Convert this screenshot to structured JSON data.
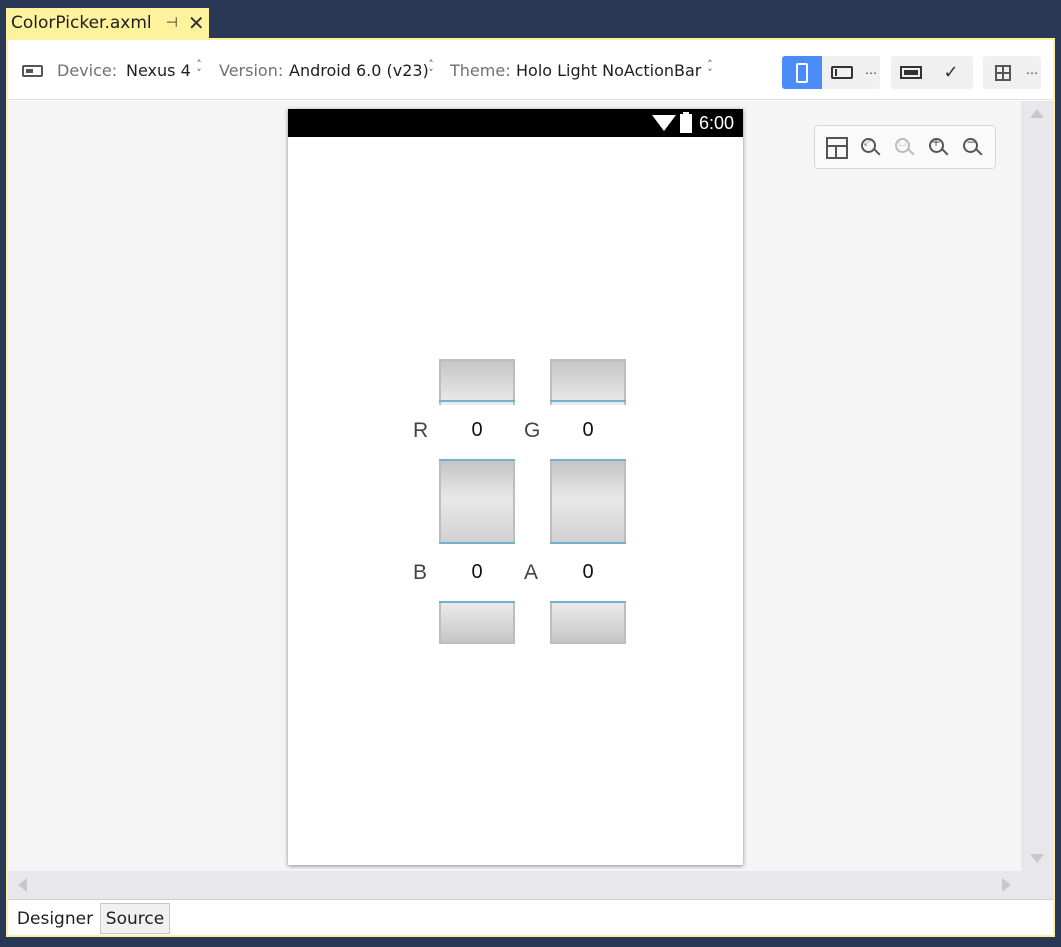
{
  "document_tab": {
    "title": "ColorPicker.axml",
    "pin_icon": "pin-icon",
    "close_icon": "close-icon"
  },
  "toolbar": {
    "device_label": "Device:",
    "device_value": "Nexus 4",
    "version_label": "Version:",
    "version_value": "Android 6.0 (v23)",
    "theme_label": "Theme:",
    "theme_value": "Holo Light NoActionBar",
    "more": "⋯",
    "accent_color": "#4b8df8"
  },
  "status_bar": {
    "time": "6:00"
  },
  "pickers": [
    {
      "label": "R",
      "value": "0"
    },
    {
      "label": "G",
      "value": "0"
    },
    {
      "label": "B",
      "value": "0"
    },
    {
      "label": "A",
      "value": "0"
    }
  ],
  "zoom_toolbar": {
    "icons": [
      "layout-icon",
      "zoom-to-fit-icon",
      "zoom-to-selection-icon",
      "zoom-in-icon",
      "zoom-out-icon"
    ]
  },
  "bottom_tabs": [
    {
      "label": "Designer",
      "active": true
    },
    {
      "label": "Source",
      "active": false
    }
  ]
}
